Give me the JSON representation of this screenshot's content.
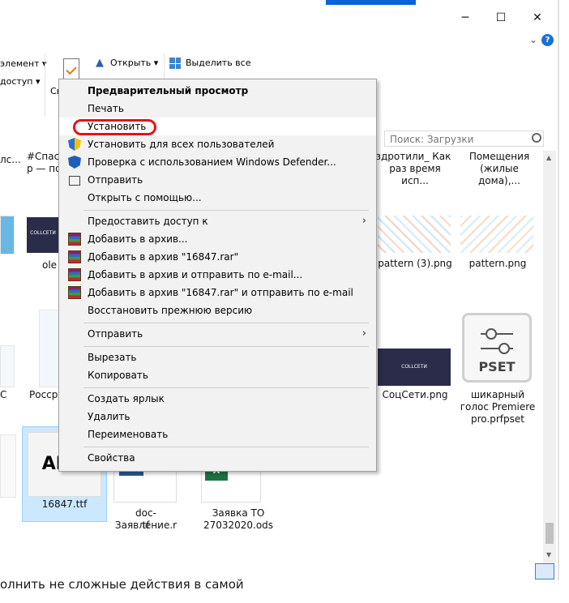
{
  "window": {
    "minimize_glyph": "─",
    "maximize_glyph": "☐",
    "close_glyph": "✕",
    "help_glyph": "?",
    "collapse_glyph": "⌄"
  },
  "ribbon": {
    "select_label": "элемент ▾",
    "access_label": "доступ ▾",
    "open_label": "Открыть ▾",
    "select_all_label": "Выделить все",
    "partial_label": "Св"
  },
  "search": {
    "placeholder": "Поиск: Загрузки"
  },
  "files": {
    "top_left_1": "#Спас",
    "top_left_2": "р — по",
    "top_left_0a": "лс...",
    "top_left_0b": "",
    "top_r1a": "здротили_ Как",
    "top_r1b": "раз время исп...",
    "top_r2a": "Помещения",
    "top_r2b": "(жилые дома),...",
    "ole_label": "ole",
    "coll_text": "COLLСЕТИ",
    "pattern3": "pattern (3).png",
    "pattern": "pattern.png",
    "c_label": "C",
    "rossre_label": "Россре",
    "socseti": "СоцСети.png",
    "pset_text": "PSET",
    "pset_1": "шикарный",
    "pset_2": "голос Premiere",
    "pset_3": "pro.prfpset",
    "ttf_text": "АБФ",
    "ttf_label": "16847.ttf",
    "doc_1": "doc-Заявление.r",
    "doc_2": "tf",
    "ods_1": "Заявка ТО",
    "ods_2": "27032020.ods"
  },
  "menu": {
    "items": [
      {
        "label": "Предварительный просмотр"
      },
      {
        "label": "Печать"
      },
      {
        "label": "Установить"
      },
      {
        "label": "Установить для всех пользователей"
      },
      {
        "label": "Проверка с использованием Windows Defender..."
      },
      {
        "label": "Отправить"
      },
      {
        "label": "Открыть с помощью..."
      },
      {
        "label": "Предоставить доступ к"
      },
      {
        "label": "Добавить в архив..."
      },
      {
        "label": "Добавить в архив \"16847.rar\""
      },
      {
        "label": "Добавить в архив и отправить по e-mail..."
      },
      {
        "label": "Добавить в архив \"16847.rar\" и отправить по e-mail"
      },
      {
        "label": "Восстановить прежнюю версию"
      },
      {
        "label": "Отправить"
      },
      {
        "label": "Вырезать"
      },
      {
        "label": "Копировать"
      },
      {
        "label": "Создать ярлык"
      },
      {
        "label": "Удалить"
      },
      {
        "label": "Переименовать"
      },
      {
        "label": "Свойства"
      }
    ],
    "submenu_arrow": "›"
  },
  "bottom_text": "олнить не сложные действия в самой",
  "colors": {
    "highlight_ring": "#e3141b",
    "accent": "#0a64d8"
  }
}
